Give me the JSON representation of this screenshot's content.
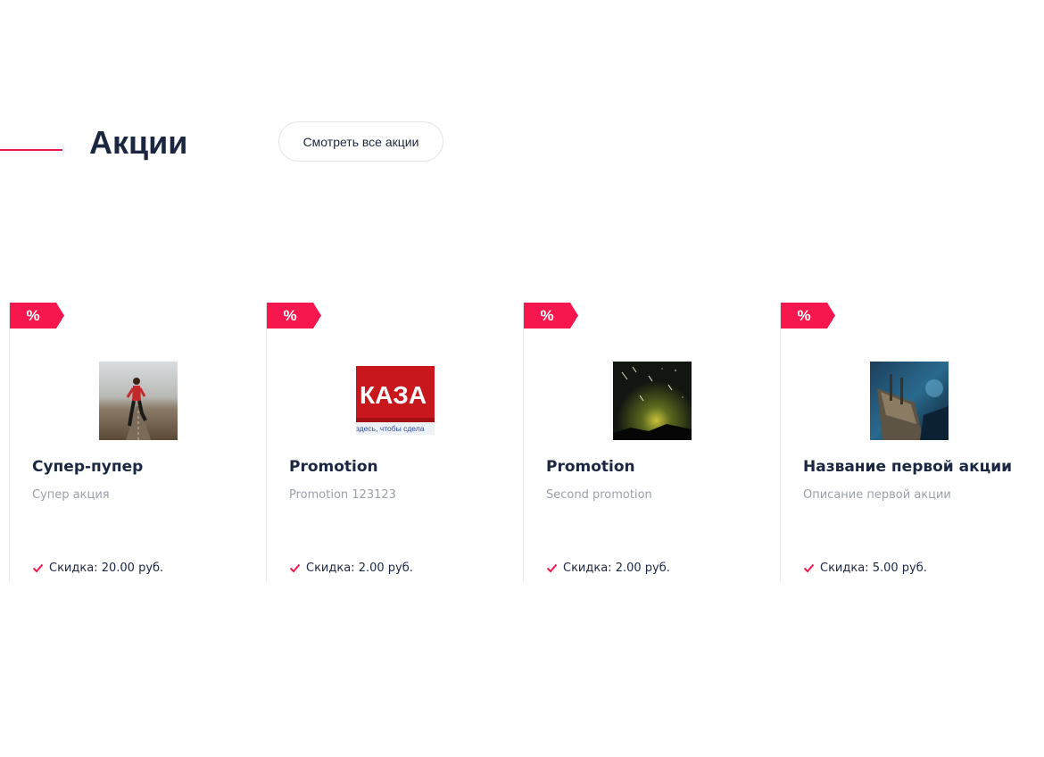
{
  "section": {
    "title": "Акции",
    "view_all_label": "Смотреть все акции"
  },
  "colors": {
    "accent": "#f5174d",
    "title": "#1b2640",
    "muted": "#9aa0aa"
  },
  "promotions": [
    {
      "badge": "%",
      "image_icon": "runner-photo",
      "title": "Супер-пупер",
      "description": "Супер акция",
      "discount_label": "Скидка:",
      "discount_value": "20.00 руб."
    },
    {
      "badge": "%",
      "image_icon": "kazan-banner-photo",
      "image_text_main": "КАЗА",
      "image_text_sub": "здесь, чтобы сдела",
      "title": "Promotion",
      "description": "Promotion 123123",
      "discount_label": "Скидка:",
      "discount_value": "2.00 руб."
    },
    {
      "badge": "%",
      "image_icon": "night-sky-photo",
      "title": "Promotion",
      "description": "Second promotion",
      "discount_label": "Скидка:",
      "discount_value": "2.00 руб."
    },
    {
      "badge": "%",
      "image_icon": "ship-photo",
      "title": "Название первой акции",
      "description": "Описание первой акции",
      "discount_label": "Скидка:",
      "discount_value": "5.00 руб."
    }
  ]
}
